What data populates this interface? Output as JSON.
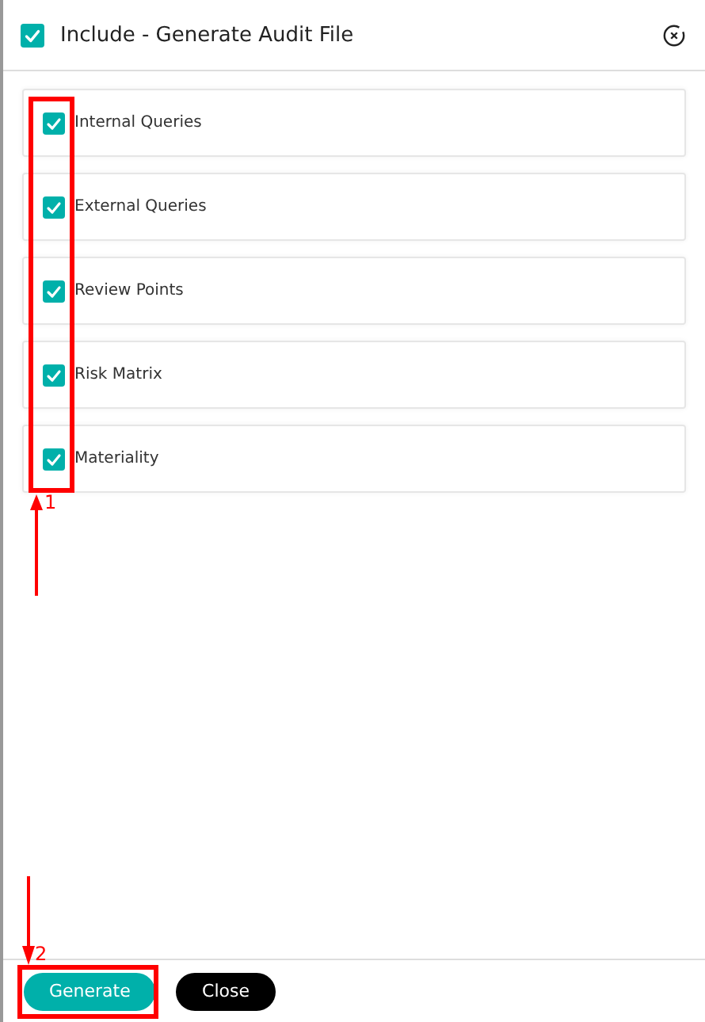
{
  "dialog": {
    "title": "Include - Generate Audit File",
    "checked": true
  },
  "items": [
    {
      "label": "Internal Queries",
      "checked": true
    },
    {
      "label": "External Queries",
      "checked": true
    },
    {
      "label": "Review Points",
      "checked": true
    },
    {
      "label": "Risk Matrix",
      "checked": true
    },
    {
      "label": "Materiality",
      "checked": true
    }
  ],
  "buttons": [
    {
      "label": "Generate",
      "kind": "primary"
    },
    {
      "label": "Close",
      "kind": "dark"
    }
  ],
  "annotations": [
    {
      "number": "1"
    },
    {
      "number": "2"
    }
  ]
}
